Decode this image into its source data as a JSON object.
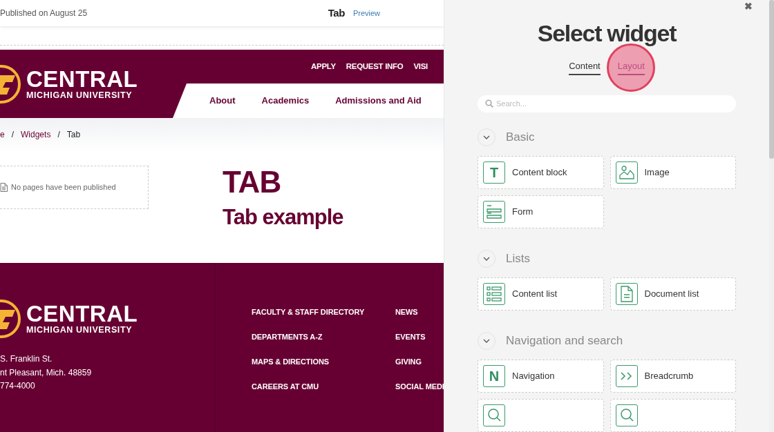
{
  "editor_bar": {
    "published": "Published on August 25",
    "page_title": "Tab",
    "preview_link": "Preview"
  },
  "site_header": {
    "logo": {
      "wordmark": "CENTRAL",
      "subtitle": "MICHIGAN UNIVERSITY"
    },
    "utility_links": [
      "APPLY",
      "REQUEST INFO",
      "VISI"
    ],
    "main_nav": [
      "About",
      "Academics",
      "Admissions and Aid"
    ]
  },
  "breadcrumb": {
    "separator": "/",
    "items": [
      "e",
      "Widgets",
      "Tab"
    ]
  },
  "published_pages_box": {
    "message": "No pages have been published"
  },
  "page_heading": "TAB",
  "subheading": "Tab example",
  "footer": {
    "logo": {
      "wordmark": "CENTRAL",
      "subtitle": "MICHIGAN UNIVERSITY"
    },
    "address_lines": [
      "S. Franklin St.",
      "nt Pleasant, Mich. 48859",
      "774-4000"
    ],
    "link_columns": [
      [
        "FACULTY & STAFF DIRECTORY",
        "DEPARTMENTS A-Z",
        "MAPS & DIRECTIONS",
        "CAREERS AT CMU"
      ],
      [
        "NEWS",
        "EVENTS",
        "GIVING",
        "SOCIAL MEDI"
      ]
    ]
  },
  "widget_panel": {
    "close_button": "✖",
    "title": "Select widget",
    "tabs": [
      {
        "label": "Content",
        "selected": true,
        "hovered": false
      },
      {
        "label": "Layout",
        "selected": false,
        "hovered": true
      }
    ],
    "search": {
      "placeholder": "Search..."
    },
    "sections": [
      {
        "name": "Basic",
        "widgets": [
          {
            "kind": "letter",
            "glyph": "T",
            "label": "Content block"
          },
          {
            "kind": "image",
            "label": "Image"
          },
          {
            "kind": "form",
            "label": "Form"
          }
        ]
      },
      {
        "name": "Lists",
        "widgets": [
          {
            "kind": "list",
            "label": "Content list"
          },
          {
            "kind": "document",
            "label": "Document list"
          }
        ]
      },
      {
        "name": "Navigation and search",
        "widgets": [
          {
            "kind": "letter",
            "glyph": "N",
            "label": "Navigation"
          },
          {
            "kind": "chevrons",
            "label": "Breadcrumb"
          },
          {
            "kind": "search"
          },
          {
            "kind": "search"
          }
        ]
      }
    ]
  }
}
